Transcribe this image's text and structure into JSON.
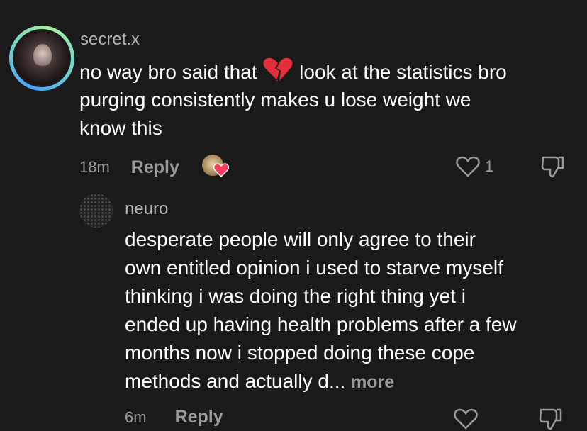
{
  "comment": {
    "username": "secret.x",
    "text_line1_a": "no way bro said that",
    "text_line1_b": "look at the statistics bro",
    "text_line2": "purging consistently makes u lose weight we",
    "text_line3": "know this",
    "time": "18m",
    "reply_label": "Reply",
    "like_count": "1",
    "icons": [
      "broken-heart-emoji",
      "creator-liked-badge",
      "heart-icon",
      "dislike-icon"
    ]
  },
  "reply_comment": {
    "username": "neuro",
    "lines": [
      "desperate people will only agree to their",
      "own entitled opinion i used to starve myself",
      "thinking i was doing the right thing yet i",
      "ended up having health problems after a few",
      "months now i stopped doing these cope",
      "methods and actually d..."
    ],
    "more_label": "more",
    "time": "6m",
    "reply_label": "Reply"
  },
  "colors": {
    "background": "#1a1a1a",
    "muted": "#9a9a9a",
    "like": "#ff3b5c"
  }
}
